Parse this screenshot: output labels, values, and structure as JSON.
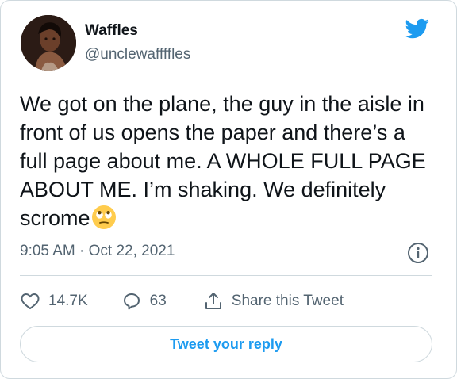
{
  "tweet": {
    "author": {
      "name": "Waffles",
      "handle": "@unclewaffffles"
    },
    "text": "We got on the plane, the guy in the aisle in front of us opens the paper and there’s a full page about me. A WHOLE FULL PAGE ABOUT ME. I’m shaking. We definitely scrome",
    "emoji": "rolling-eyes-face",
    "time": "9:05 AM",
    "separator": "·",
    "date": "Oct 22, 2021"
  },
  "actions": {
    "likes": "14.7K",
    "replies": "63",
    "share_label": "Share this Tweet"
  },
  "reply_button": "Tweet your reply",
  "icons": {
    "brand": "twitter-bird-icon",
    "info": "info-icon",
    "like": "heart-icon",
    "reply": "speech-bubble-icon",
    "share": "share-upload-icon"
  },
  "colors": {
    "accent": "#1d9bf0",
    "text": "#0f1419",
    "secondary": "#536471",
    "border": "#cfd9de"
  }
}
